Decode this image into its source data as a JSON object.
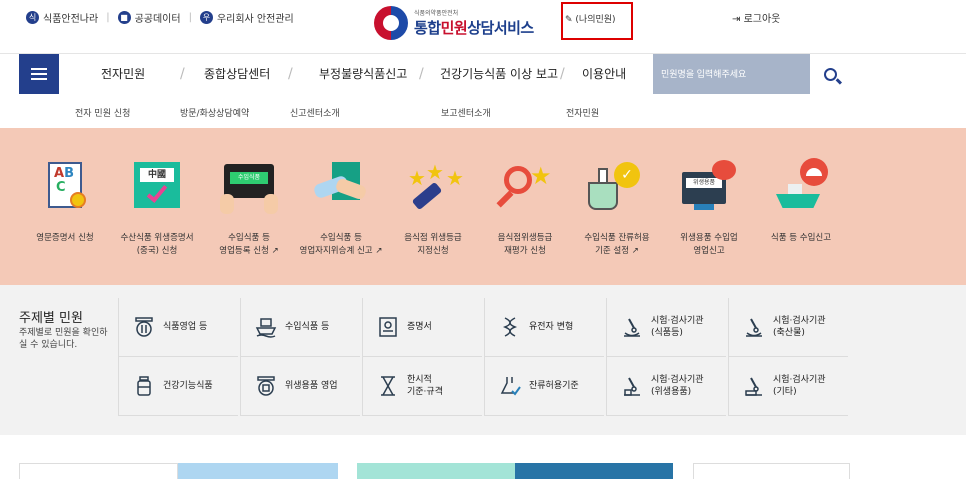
{
  "header": {
    "links": [
      {
        "label": "식품안전나라",
        "icon": "식"
      },
      {
        "label": "공공데이터",
        "icon": "■"
      },
      {
        "label": "우리회사 안전관리",
        "icon": "우"
      }
    ],
    "logo_sub": "식품의약품안전처",
    "logo_main_a": "통합",
    "logo_main_b": "민원",
    "logo_main_c": "상담서비스",
    "my_complaint": "(나의민원)",
    "logout": "로그아웃"
  },
  "nav": {
    "items": [
      "전자민원",
      "종합상담센터",
      "부정불량식품신고",
      "건강기능식품 이상 보고",
      "이용안내"
    ],
    "search_placeholder": "민원명을 입력해주세요"
  },
  "subnav": [
    "전자 민원 신청",
    "방문/화상상담예약",
    "신고센터소개",
    "보고센터소개",
    "전자민원"
  ],
  "services": [
    {
      "label": "영문증명서 신청",
      "icon": "abc-certificate-icon"
    },
    {
      "label": "수산식품 위생증명서\n(중국) 신청",
      "icon": "china-certificate-icon"
    },
    {
      "label": "수입식품 등\n영업등록 신청 ↗",
      "icon": "import-tablet-icon"
    },
    {
      "label": "수입식품 등\n영업자지위승계 신고 ↗",
      "icon": "handshake-icon"
    },
    {
      "label": "음식점 위생등급\n지정신청",
      "icon": "stars-icon"
    },
    {
      "label": "음식점위생등급\n재평가 신청",
      "icon": "magnifier-star-icon"
    },
    {
      "label": "수입식품 잔류허용\n기준 설정 ↗",
      "icon": "flask-check-icon"
    },
    {
      "label": "위생용품 수입업\n영업신고",
      "icon": "hygiene-monitor-icon"
    },
    {
      "label": "식품 등 수입신고",
      "icon": "ship-icon"
    }
  ],
  "topics": {
    "title": "주제별 민원",
    "desc": "주제별로 민원을 확인하실 수 있습니다.",
    "row1": [
      "식품영업 등",
      "수입식품 등",
      "증명서",
      "유전자 변형",
      "시험·검사기관\n(식품등)",
      "시험·검사기관\n(축산물)"
    ],
    "row2": [
      "건강기능식품",
      "위생용품 영업",
      "한시적\n기준·규격",
      "잔류허용기준",
      "시험·검사기관\n(위생용품)",
      "시험·검사기관\n(기타)"
    ]
  },
  "colors": {
    "brand": "#233f8c",
    "service_bg": "#f4c9b7",
    "highlight_box": "#dd0000"
  }
}
